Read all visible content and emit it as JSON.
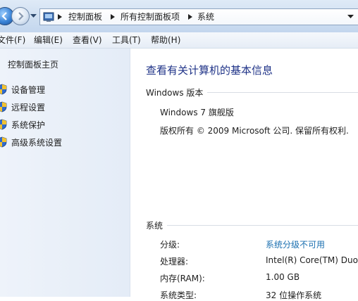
{
  "address": {
    "crumbs": [
      "控制面板",
      "所有控制面板项",
      "系统"
    ]
  },
  "menu": {
    "items": [
      "文件(F)",
      "编辑(E)",
      "查看(V)",
      "工具(T)",
      "帮助(H)"
    ]
  },
  "sidebar": {
    "home": "控制面板主页",
    "tasks": [
      "设备管理",
      "远程设置",
      "系统保护",
      "高级系统设置"
    ]
  },
  "main": {
    "title": "查看有关计算机的基本信息",
    "windows_section": {
      "heading": "Windows 版本",
      "edition": "Windows 7 旗舰版",
      "copyright": "版权所有 © 2009 Microsoft 公司. 保留所有权利."
    },
    "system_section": {
      "heading": "系统",
      "rows": [
        {
          "label": "分级:",
          "value": "系统分级不可用"
        },
        {
          "label": "处理器:",
          "value": "Intel(R) Core(TM) Duo"
        },
        {
          "label": "内存(RAM):",
          "value": "1.00 GB"
        },
        {
          "label": "系统类型:",
          "value": "32 位操作系统"
        }
      ]
    }
  },
  "colors": {
    "title": "#1e3287",
    "link": "#1a6fb0"
  }
}
